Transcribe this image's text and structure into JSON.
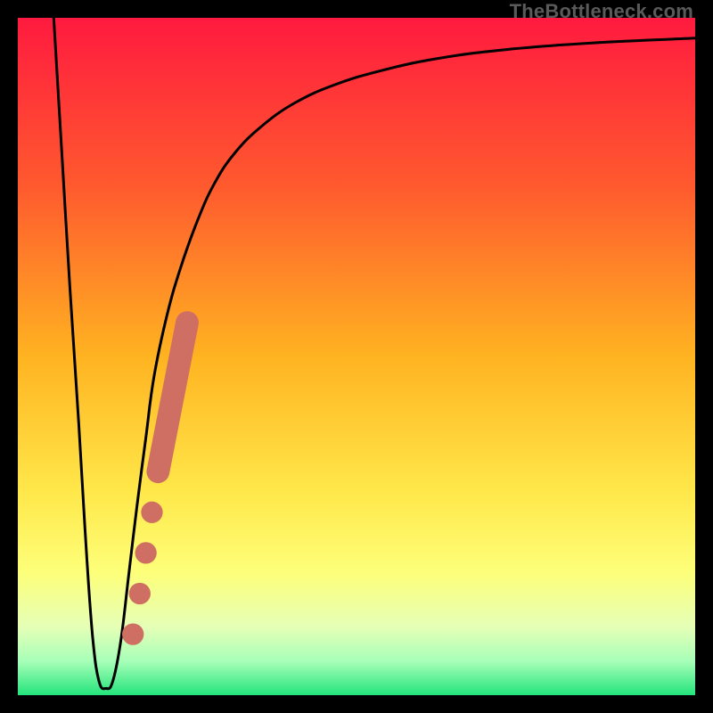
{
  "watermark": "TheBottleneck.com",
  "colors": {
    "frame": "#000000",
    "curve": "#000000",
    "markers": "#cf6f63",
    "gradient_stops": [
      {
        "offset": 0.0,
        "color": "#ff1a3f"
      },
      {
        "offset": 0.25,
        "color": "#ff5a2e"
      },
      {
        "offset": 0.5,
        "color": "#ffb321"
      },
      {
        "offset": 0.7,
        "color": "#ffe84a"
      },
      {
        "offset": 0.82,
        "color": "#fdff7a"
      },
      {
        "offset": 0.9,
        "color": "#e5ffb7"
      },
      {
        "offset": 0.95,
        "color": "#a7ffb8"
      },
      {
        "offset": 1.0,
        "color": "#23e47b"
      }
    ]
  },
  "chart_data": {
    "type": "line",
    "title": "",
    "xlabel": "",
    "ylabel": "",
    "xlim": [
      0,
      100
    ],
    "ylim": [
      0,
      100
    ],
    "series": [
      {
        "name": "bottleneck-curve",
        "x": [
          5.3,
          6.5,
          7.7,
          9.0,
          10.2,
          11.1,
          12.0,
          13.0,
          14.0,
          15.2,
          16.4,
          17.6,
          18.9,
          20.1,
          22.0,
          24.0,
          26.5,
          29.0,
          32.0,
          36.0,
          41.0,
          47.0,
          54.0,
          62.0,
          72.0,
          85.0,
          100.0
        ],
        "y": [
          100.0,
          80.0,
          60.0,
          40.0,
          20.0,
          8.0,
          2.0,
          1.0,
          2.0,
          8.0,
          18.0,
          28.0,
          38.0,
          47.0,
          56.0,
          63.0,
          70.0,
          75.5,
          80.0,
          84.0,
          87.5,
          90.2,
          92.3,
          94.0,
          95.3,
          96.3,
          97.0
        ]
      }
    ],
    "markers": {
      "name": "highlighted-points",
      "points": [
        {
          "x": 17.0,
          "y": 9.0,
          "r": 1.6
        },
        {
          "x": 18.0,
          "y": 15.0,
          "r": 1.6
        },
        {
          "x": 18.9,
          "y": 21.0,
          "r": 1.6
        },
        {
          "x": 19.8,
          "y": 27.0,
          "r": 1.6
        }
      ],
      "segment": {
        "x1": 20.7,
        "y1": 33.0,
        "x2": 25.0,
        "y2": 55.0,
        "width": 3.4
      }
    }
  }
}
